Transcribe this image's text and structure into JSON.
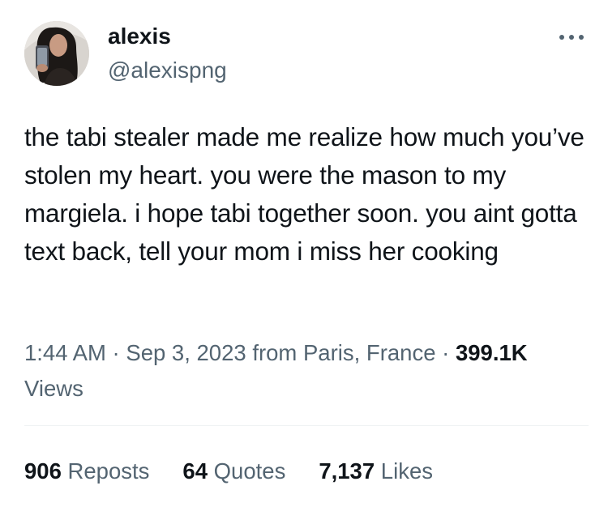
{
  "author": {
    "display_name": "alexis",
    "handle": "@alexispng",
    "avatar_icon": "profile-photo"
  },
  "menu": {
    "more_icon": "more-horizontal-icon"
  },
  "tweet": {
    "text": "the tabi stealer made me realize how much you’ve stolen my heart. you were the mason to my margiela. i hope tabi together soon. you aint gotta text back, tell your mom i miss her cooking"
  },
  "meta": {
    "time": "1:44 AM",
    "separator": "·",
    "date": "Sep 3, 2023",
    "location": "from Paris, France",
    "views_count": "399.1K",
    "views_label": "Views"
  },
  "stats": {
    "reposts_count": "906",
    "reposts_label": "Reposts",
    "quotes_count": "64",
    "quotes_label": "Quotes",
    "likes_count": "7,137",
    "likes_label": "Likes"
  },
  "colors": {
    "text_primary": "#0f1419",
    "text_secondary": "#536471",
    "divider": "#eff3f4"
  }
}
